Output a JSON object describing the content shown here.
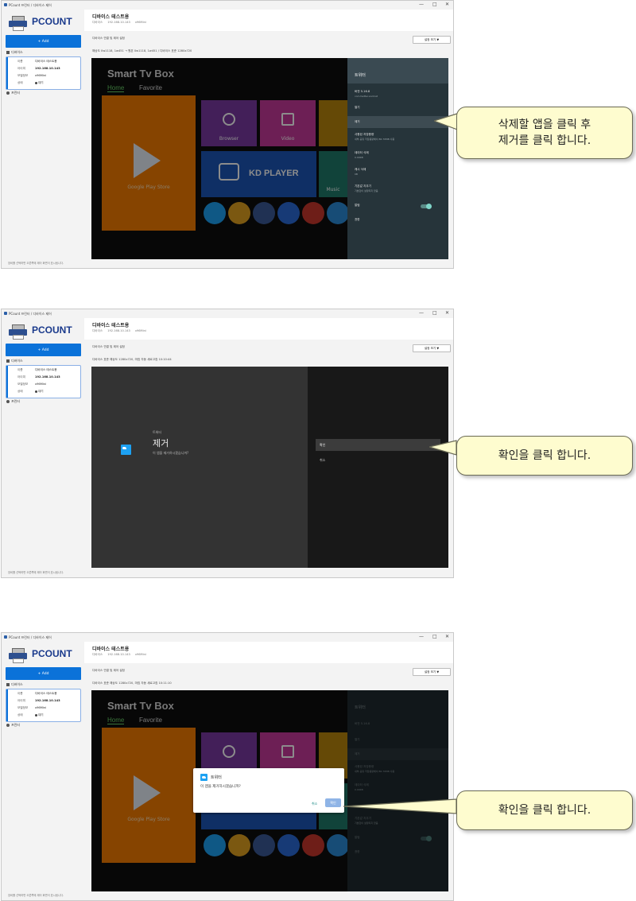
{
  "window": {
    "title": "PCount 프린터 / 디바이스 제어",
    "brand": "PCOUNT",
    "controls": [
      "—",
      "□",
      "✕"
    ]
  },
  "sidebar": {
    "add_label": "+ Add",
    "nav_devices": "디바이스",
    "nav_printer": "프린터",
    "card": {
      "name_key": "이름",
      "name_val": "디바이스 테스트용",
      "ip_key": "아이피",
      "ip_val": "192.168.10.143",
      "model_key": "모델정보",
      "model_val": "x96Mini",
      "status_key": "상태",
      "status_val": "대기"
    },
    "footer": "장비를 선택하면 오른쪽에 제어 화면이 표시됩니다."
  },
  "header": {
    "device_title": "디바이스 테스트용",
    "sub_type": "디바이스",
    "sub_ip": "192.168.10.143",
    "sub_model": "x96Mini",
    "toolbar_label": "디바이스 연결 및 제어 설정",
    "settings_btn": "설정 보기 ▼"
  },
  "steps": [
    {
      "info": "해상도 0w1118, 1w451 → 원본 0w1118, 1w451 / 디바이스 표준 1280x720",
      "callout": "삭제할 앱을 클릭 후 제거를 클릭 합니다.",
      "callout_line1": "삭제할 앱을 클릭 후",
      "callout_line2": "제거를 클릭 합니다."
    },
    {
      "info": "디바이스 표준 해상도 1280x720, 마침 자동 새로고침 10:10:44",
      "callout": "확인을 클릭 합니다."
    },
    {
      "info": "디바이스 표준 해상도 1280x720, 마침 자동 새로고침 10:11:10",
      "callout": "확인을 클릭 합니다."
    }
  ],
  "smarttv": {
    "title_a": "Smart",
    "title_b": "Tv Box",
    "tab_home": "Home",
    "tab_fav": "Favorite",
    "gps": "Google Play Store",
    "tile_browser": "Browser",
    "tile_video": "Video",
    "tile_music": "Music",
    "kdplayer": "KD PLAYER"
  },
  "appinfo": {
    "title": "트위터",
    "version": "버전 5.16.8",
    "version_sub": "com.twitter.android",
    "open": "열기",
    "remove": "제거",
    "storage": "사용된 저장용량",
    "storage_sub": "내부 공유 저장용량에서 86.70MB 사용",
    "clear_data": "데이터 삭제",
    "clear_data_sub": "0.00KB",
    "clear_cache": "캐시 삭제",
    "clear_cache_sub": "0B",
    "default_open": "기본값 지우기",
    "default_open_sub": "기본값이 설정되지 않음",
    "notif": "알림",
    "perm": "권한"
  },
  "confirm": {
    "app": "트위터",
    "title": "제거",
    "question": "이 앱을 제거하시겠습니까?",
    "ok": "확인",
    "cancel": "취소"
  },
  "dialog": {
    "app": "트위터",
    "question": "이 앱을 제거하시겠습니까?",
    "cancel": "취소",
    "ok": "확인"
  },
  "colors": {
    "accent": "#0b72d9",
    "play_store": "#f57c00",
    "kd_player": "#1c57b8",
    "twitter": "#1da1f2"
  }
}
